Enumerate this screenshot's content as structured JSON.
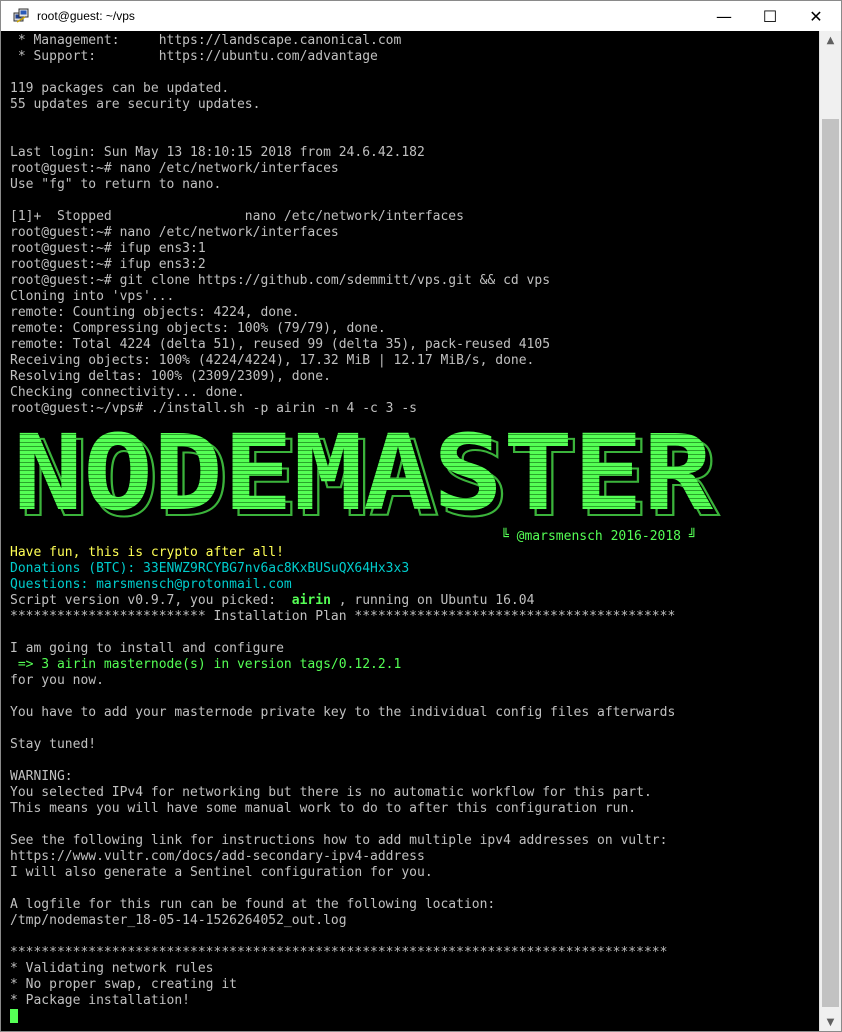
{
  "window": {
    "title": "root@guest: ~/vps",
    "min_glyph": "—",
    "max_glyph": "☐",
    "close_glyph": "✕"
  },
  "terminal": {
    "lines": [
      " * Management:     https://landscape.canonical.com",
      " * Support:        https://ubuntu.com/advantage",
      "",
      "119 packages can be updated.",
      "55 updates are security updates.",
      "",
      "",
      "Last login: Sun May 13 18:10:15 2018 from 24.6.42.182",
      "root@guest:~# nano /etc/network/interfaces",
      "Use \"fg\" to return to nano.",
      "",
      "[1]+  Stopped                 nano /etc/network/interfaces",
      "root@guest:~# nano /etc/network/interfaces",
      "root@guest:~# ifup ens3:1",
      "root@guest:~# ifup ens3:2",
      "root@guest:~# git clone https://github.com/sdemmitt/vps.git && cd vps",
      "Cloning into 'vps'...",
      "remote: Counting objects: 4224, done.",
      "remote: Compressing objects: 100% (79/79), done.",
      "remote: Total 4224 (delta 51), reused 99 (delta 35), pack-reused 4105",
      "Receiving objects: 100% (4224/4224), 17.32 MiB | 12.17 MiB/s, done.",
      "Resolving deltas: 100% (2309/2309), done.",
      "Checking connectivity... done.",
      "root@guest:~/vps# ./install.sh -p airin -n 4 -c 3 -s"
    ],
    "banner_text": "NODEMASTER",
    "signature": "╚ @marsmensch 2016-2018 ╝",
    "have_fun": "Have fun, this is crypto after all!",
    "donations": "Donations (BTC): 33ENWZ9RCYBG7nv6ac8KxBUSuQX64Hx3x3",
    "questions": "Questions: marsmensch@protonmail.com",
    "script_version_prefix": "Script version v0.9.7, you picked: ",
    "picked": " airin ",
    "script_version_suffix": ", running on Ubuntu 16.04",
    "plan_header": "************************* Installation Plan *****************************************",
    "lines2": [
      "",
      "I am going to install and configure"
    ],
    "install_target": " => 3 airin masternode(s) in version tags/0.12.2.1",
    "lines3": [
      "for you now.",
      "",
      "You have to add your masternode private key to the individual config files afterwards",
      "",
      "Stay tuned!",
      "",
      "WARNING:",
      "You selected IPv4 for networking but there is no automatic workflow for this part.",
      "This means you will have some manual work to do to after this configuration run.",
      "",
      "See the following link for instructions how to add multiple ipv4 addresses on vultr:",
      "https://www.vultr.com/docs/add-secondary-ipv4-address",
      "I will also generate a Sentinel configuration for you.",
      "",
      "A logfile for this run can be found at the following location:",
      "/tmp/nodemaster_18-05-14-1526264052_out.log",
      "",
      "************************************************************************************",
      "* Validating network rules",
      "* No proper swap, creating it",
      "* Package installation!"
    ]
  },
  "scrollbar": {
    "up_glyph": "▲",
    "down_glyph": "▼"
  }
}
